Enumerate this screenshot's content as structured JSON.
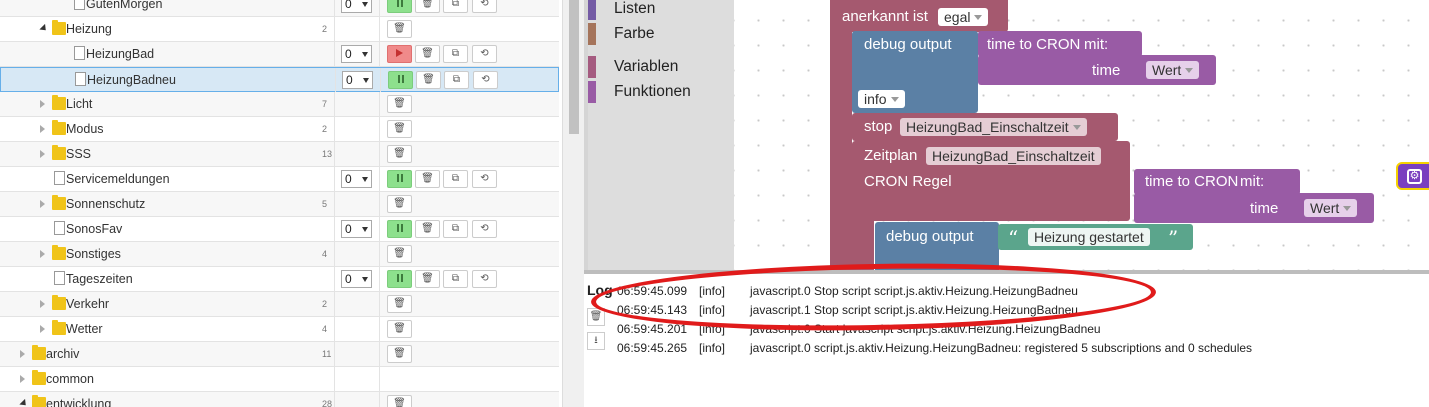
{
  "tree": {
    "rows": [
      {
        "name": "GutenMorgen",
        "indent": 2,
        "type": "file",
        "count": "",
        "selectValue": "0",
        "controls": "run",
        "state": "running"
      },
      {
        "name": "Heizung",
        "indent": 1,
        "type": "folder",
        "expanded": true,
        "count": "2",
        "controls": "delete"
      },
      {
        "name": "HeizungBad",
        "indent": 2,
        "type": "file",
        "count": "",
        "selectValue": "0",
        "controls": "run",
        "state": "stopped"
      },
      {
        "name": "HeizungBadneu",
        "indent": 2,
        "type": "file",
        "count": "",
        "selectValue": "0",
        "controls": "run",
        "state": "running",
        "selected": true
      },
      {
        "name": "Licht",
        "indent": 1,
        "type": "folder",
        "expanded": false,
        "count": "7",
        "controls": "delete"
      },
      {
        "name": "Modus",
        "indent": 1,
        "type": "folder",
        "expanded": false,
        "count": "2",
        "controls": "delete"
      },
      {
        "name": "SSS",
        "indent": 1,
        "type": "folder",
        "expanded": false,
        "count": "13",
        "controls": "delete"
      },
      {
        "name": "Servicemeldungen",
        "indent": 1,
        "type": "file",
        "count": "",
        "selectValue": "0",
        "controls": "run",
        "state": "running"
      },
      {
        "name": "Sonnenschutz",
        "indent": 1,
        "type": "folder",
        "expanded": false,
        "count": "5",
        "controls": "delete"
      },
      {
        "name": "SonosFav",
        "indent": 1,
        "type": "file",
        "count": "",
        "selectValue": "0",
        "controls": "run",
        "state": "running"
      },
      {
        "name": "Sonstiges",
        "indent": 1,
        "type": "folder",
        "expanded": false,
        "count": "4",
        "controls": "delete"
      },
      {
        "name": "Tageszeiten",
        "indent": 1,
        "type": "file",
        "count": "",
        "selectValue": "0",
        "controls": "run",
        "state": "running"
      },
      {
        "name": "Verkehr",
        "indent": 1,
        "type": "folder",
        "expanded": false,
        "count": "2",
        "controls": "delete"
      },
      {
        "name": "Wetter",
        "indent": 1,
        "type": "folder",
        "expanded": false,
        "count": "4",
        "controls": "delete"
      },
      {
        "name": "archiv",
        "indent": 0,
        "type": "folder",
        "expanded": false,
        "count": "11",
        "controls": "delete"
      },
      {
        "name": "common",
        "indent": 0,
        "type": "folder",
        "expanded": false,
        "count": "",
        "controls": "none"
      },
      {
        "name": "entwicklung",
        "indent": 0,
        "type": "folder",
        "expanded": true,
        "count": "28",
        "controls": "delete"
      }
    ]
  },
  "toolbox": {
    "categories": [
      {
        "label": "Listen",
        "color": "#745ba5"
      },
      {
        "label": "Farbe",
        "color": "#a5745b"
      },
      {
        "label": "Variablen",
        "color": "#a55b80"
      },
      {
        "label": "Funktionen",
        "color": "#995ba5"
      }
    ]
  },
  "blocks": {
    "anerkannt_label": "anerkannt ist",
    "anerkannt_value": "egal",
    "debug_output_label": "debug output",
    "time_to_cron_label": "time to CRON",
    "mit_label": "mit:",
    "time_label": "time",
    "wert_value": "Wert",
    "info_value": "info",
    "stop_label": "stop",
    "stop_value": "HeizungBad_Einschaltzeit",
    "zeitplan_label": "Zeitplan",
    "zeitplan_value": "HeizungBad_Einschaltzeit",
    "cron_regel_label": "CRON Regel",
    "heizung_gestartet": "Heizung gestartet",
    "colors": {
      "event": "#a5596f",
      "debug": "#5b80a5",
      "purple": "#995ba5",
      "text": "#5ba58c"
    }
  },
  "log": {
    "title": "Log",
    "lines": [
      {
        "time": "06:59:45.099",
        "level": "[info]",
        "message": "javascript.0 Stop script script.js.aktiv.Heizung.HeizungBadneu"
      },
      {
        "time": "06:59:45.143",
        "level": "[info]",
        "message": "javascript.1 Stop script script.js.aktiv.Heizung.HeizungBadneu"
      },
      {
        "time": "06:59:45.201",
        "level": "[info]",
        "message": "javascript.0 Start javascript script.js.aktiv.Heizung.HeizungBadneu"
      },
      {
        "time": "06:59:45.265",
        "level": "[info]",
        "message": "javascript.0 script.js.aktiv.Heizung.HeizungBadneu: registered 5 subscriptions and 0 schedules"
      }
    ]
  }
}
